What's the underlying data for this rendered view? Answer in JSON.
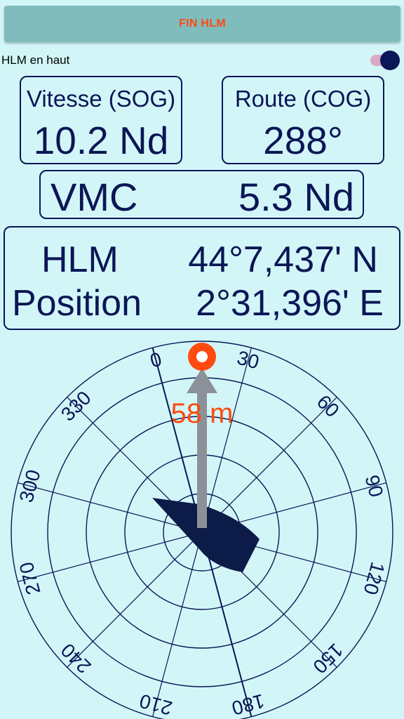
{
  "top_button": {
    "label": "FIN HLM"
  },
  "toggle": {
    "label": "HLM en haut",
    "on": true
  },
  "sog": {
    "label": "Vitesse (SOG)",
    "value": "10.2 Nd"
  },
  "cog": {
    "label": "Route (COG)",
    "value": "288°"
  },
  "vmc": {
    "label": "VMC",
    "value": "5.3 Nd"
  },
  "position": {
    "label1": "HLM",
    "label2": "Position",
    "lat": "44°7,437' N",
    "lon": "2°31,396' E"
  },
  "compass": {
    "rotation_deg": -15,
    "tick_labels": [
      "0",
      "30",
      "60",
      "90",
      "120",
      "150",
      "180",
      "210",
      "240",
      "270",
      "300",
      "330"
    ],
    "distance_label": "58 m",
    "colors": {
      "line": "#0b1656",
      "target": "#ff4a10",
      "arrow": "#8c9199",
      "boat": "#0d1b48"
    }
  }
}
